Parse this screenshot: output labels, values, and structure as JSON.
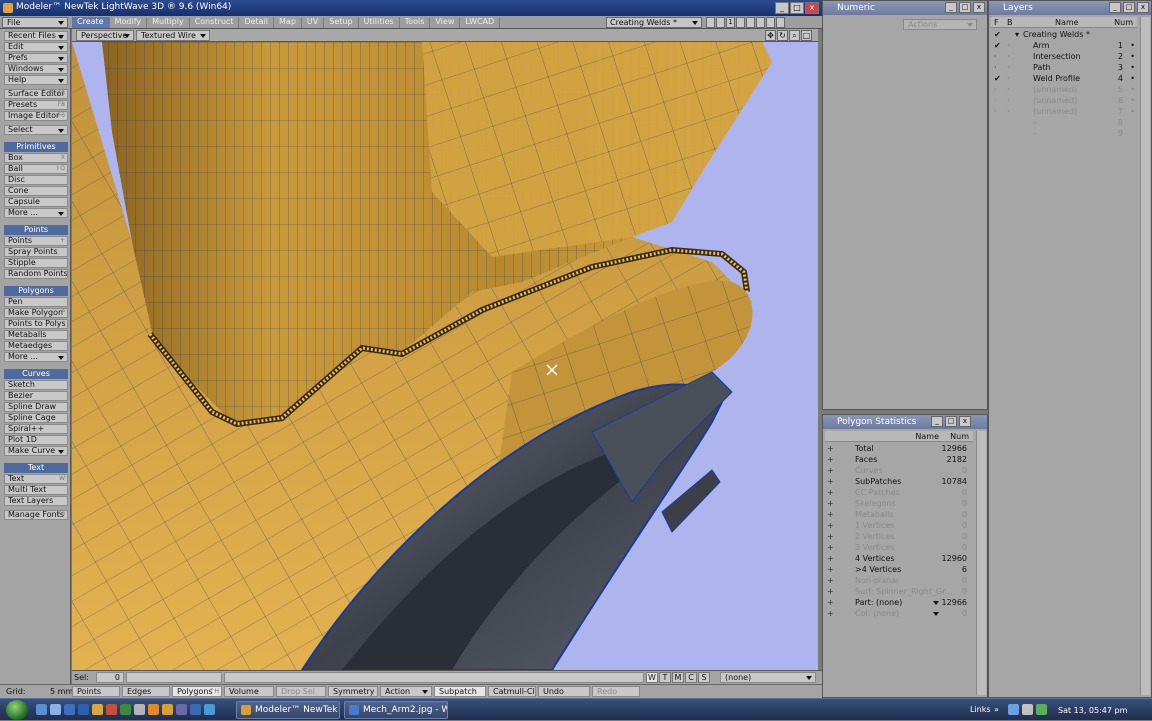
{
  "window": {
    "title": "Modeler™ NewTek LightWave 3D ® 9.6 (Win64)",
    "min": "_",
    "max": "□",
    "close": "x"
  },
  "menubar": {
    "file": "File",
    "tabs": [
      "Create",
      "Modify",
      "Multiply",
      "Construct",
      "Detail",
      "Map",
      "UV",
      "Setup",
      "Utilities",
      "Tools",
      "View",
      "LWCAD"
    ],
    "active_tab": "Create",
    "mode": "Creating Welds *",
    "page_num": "1"
  },
  "left_toolbar": {
    "top_menu": [
      "Recent Files ..",
      "Edit",
      "Prefs",
      "Windows",
      "Help"
    ],
    "editors": [
      {
        "label": "Surface Editor",
        "shortcut": "F5"
      },
      {
        "label": "Presets",
        "shortcut": "F8"
      },
      {
        "label": "Image Editor",
        "shortcut": "F6"
      }
    ],
    "select": "Select",
    "primitives_header": "Primitives",
    "primitives": [
      {
        "label": "Box",
        "shortcut": "X"
      },
      {
        "label": "Ball",
        "shortcut": "⇧O"
      },
      {
        "label": "Disc",
        "shortcut": ""
      },
      {
        "label": "Cone",
        "shortcut": ""
      },
      {
        "label": "Capsule",
        "shortcut": ""
      },
      {
        "label": "More ...",
        "shortcut": ""
      }
    ],
    "points_header": "Points",
    "points": [
      {
        "label": "Points",
        "shortcut": "+"
      },
      {
        "label": "Spray Points",
        "shortcut": ""
      },
      {
        "label": "Stipple",
        "shortcut": ""
      },
      {
        "label": "Random Points",
        "shortcut": ""
      }
    ],
    "polygons_header": "Polygons",
    "polygons": [
      {
        "label": "Pen",
        "shortcut": ""
      },
      {
        "label": "Make Polygon",
        "shortcut": "P"
      },
      {
        "label": "Points to Polys",
        "shortcut": ""
      },
      {
        "label": "Metaballs",
        "shortcut": ""
      },
      {
        "label": "Metaedges",
        "shortcut": ""
      },
      {
        "label": "More ...",
        "shortcut": ""
      }
    ],
    "curves_header": "Curves",
    "curves": [
      {
        "label": "Sketch",
        "shortcut": ""
      },
      {
        "label": "Bezier",
        "shortcut": ""
      },
      {
        "label": "Spline Draw",
        "shortcut": ""
      },
      {
        "label": "Spline Cage",
        "shortcut": ""
      },
      {
        "label": "Spiral++",
        "shortcut": ""
      },
      {
        "label": "Plot 1D",
        "shortcut": ""
      },
      {
        "label": "Make Curve",
        "shortcut": ""
      }
    ],
    "text_header": "Text",
    "text": [
      {
        "label": "Text",
        "shortcut": "W"
      },
      {
        "label": "Multi Text",
        "shortcut": ""
      },
      {
        "label": "Text Layers",
        "shortcut": ""
      }
    ],
    "manage_fonts": {
      "label": "Manage Fonts",
      "shortcut": "F0"
    }
  },
  "viewport": {
    "view": "Perspective",
    "render": "Textured Wire"
  },
  "status_bar": {
    "sel_label": "Sel:",
    "sel_value": "0",
    "wtmcs": [
      "W",
      "T",
      "M",
      "C",
      "S"
    ],
    "part": "(none)"
  },
  "bottom_bar": {
    "grid_label": "Grid:",
    "grid_value": "5 mm",
    "buttons": [
      "Points",
      "Edges",
      "Polygons",
      "Volume",
      "Drop Sel",
      "Symmetry",
      "Action",
      "Subpatch",
      "Catmull-Clark",
      "Undo",
      "Redo"
    ],
    "polygons_shortcut": "^H"
  },
  "numeric": {
    "title": "Numeric",
    "actions": "Actions"
  },
  "layers": {
    "title": "Layers",
    "col_f": "F",
    "col_b": "B",
    "col_name": "Name",
    "col_num": "Num",
    "object": "Creating Welds *",
    "rows": [
      {
        "f": "✔",
        "b": "·",
        "name": "Arm",
        "num": "1",
        "dim": false
      },
      {
        "f": "·",
        "b": "·",
        "name": "Intersection",
        "num": "2",
        "dim": false
      },
      {
        "f": "·",
        "b": "·",
        "name": "Path",
        "num": "3",
        "dim": false
      },
      {
        "f": "✔",
        "b": "·",
        "name": "Weld Profile",
        "num": "4",
        "dim": false
      },
      {
        "f": "·",
        "b": "·",
        "name": "(unnamed)",
        "num": "5",
        "dim": true
      },
      {
        "f": "·",
        "b": "·",
        "name": "(unnamed)",
        "num": "6",
        "dim": true
      },
      {
        "f": "·",
        "b": "·",
        "name": "(unnamed)",
        "num": "7",
        "dim": true
      },
      {
        "f": "",
        "b": "",
        "name": "-",
        "num": "8",
        "dim": true
      },
      {
        "f": "",
        "b": "",
        "name": "-",
        "num": "9",
        "dim": true
      }
    ]
  },
  "poly_stats": {
    "title": "Polygon Statistics",
    "col_name": "Name",
    "col_num": "Num",
    "rows": [
      {
        "name": "Total",
        "num": "12966",
        "dim": false
      },
      {
        "name": "Faces",
        "num": "2182",
        "dim": false
      },
      {
        "name": "Curves",
        "num": "0",
        "dim": true
      },
      {
        "name": "SubPatches",
        "num": "10784",
        "dim": false
      },
      {
        "name": "CC Patches",
        "num": "0",
        "dim": true
      },
      {
        "name": "Skelegons",
        "num": "0",
        "dim": true
      },
      {
        "name": "Metaballs",
        "num": "0",
        "dim": true
      },
      {
        "name": "1 Vertices",
        "num": "0",
        "dim": true
      },
      {
        "name": "2 Vertices",
        "num": "0",
        "dim": true
      },
      {
        "name": "3 Vertices",
        "num": "0",
        "dim": true
      },
      {
        "name": "4 Vertices",
        "num": "12960",
        "dim": false
      },
      {
        "name": ">4 Vertices",
        "num": "6",
        "dim": false
      },
      {
        "name": "Non-planar",
        "num": "0",
        "dim": true
      },
      {
        "name": "Surf: Spinner_Right_Gr...",
        "num": "0",
        "dim": true
      },
      {
        "name": "Part: (none)",
        "num": "12966",
        "dim": false
      },
      {
        "name": "Col: (none)",
        "num": "0",
        "dim": true
      }
    ]
  },
  "taskbar": {
    "tasks": [
      "Modeler™ NewTek ...",
      "Mech_Arm2.jpg - W..."
    ],
    "links": "Links",
    "clock": "Sat 13, 05:47 pm"
  },
  "colors": {
    "surface": "#c99a3a",
    "surface_dark": "#8a6420",
    "wire": "#1a2a60",
    "background": "#aeb5ee",
    "menu_active": "#5b78b0"
  }
}
